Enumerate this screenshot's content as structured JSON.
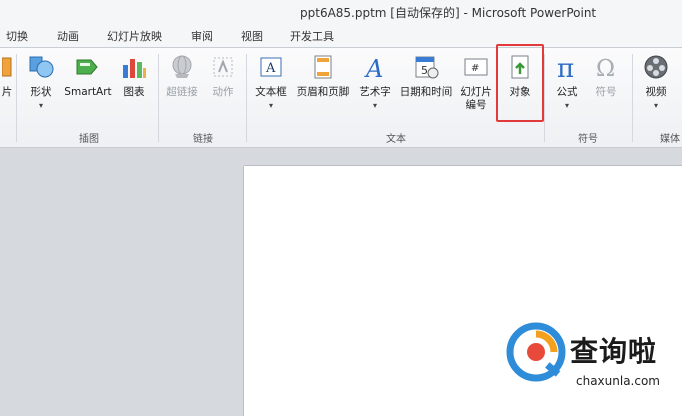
{
  "window": {
    "title": "ppt6A85.pptm [自动保存的] - Microsoft PowerPoint"
  },
  "tabs": [
    "切换",
    "动画",
    "幻灯片放映",
    "审阅",
    "视图",
    "开发工具"
  ],
  "ribbon": {
    "groups": [
      {
        "label": "插图"
      },
      {
        "label": "链接"
      },
      {
        "label": "文本"
      },
      {
        "label": "符号"
      },
      {
        "label": "媒体"
      }
    ],
    "buttons": {
      "partial": "片",
      "shape": "形状",
      "smartart": "SmartArt",
      "chart": "图表",
      "hyperlink": "超链接",
      "action": "动作",
      "textbox": "文本框",
      "header_footer": "页眉和页脚",
      "wordart": "艺术字",
      "datetime": "日期和时间",
      "slide_number_line1": "幻灯片",
      "slide_number_line2": "编号",
      "object": "对象",
      "equation": "公式",
      "symbol": "符号",
      "video": "视频"
    },
    "colors": {
      "highlight": "#e23a3a"
    }
  },
  "watermark": {
    "brand": "查询啦",
    "url": "chaxunla.com"
  }
}
